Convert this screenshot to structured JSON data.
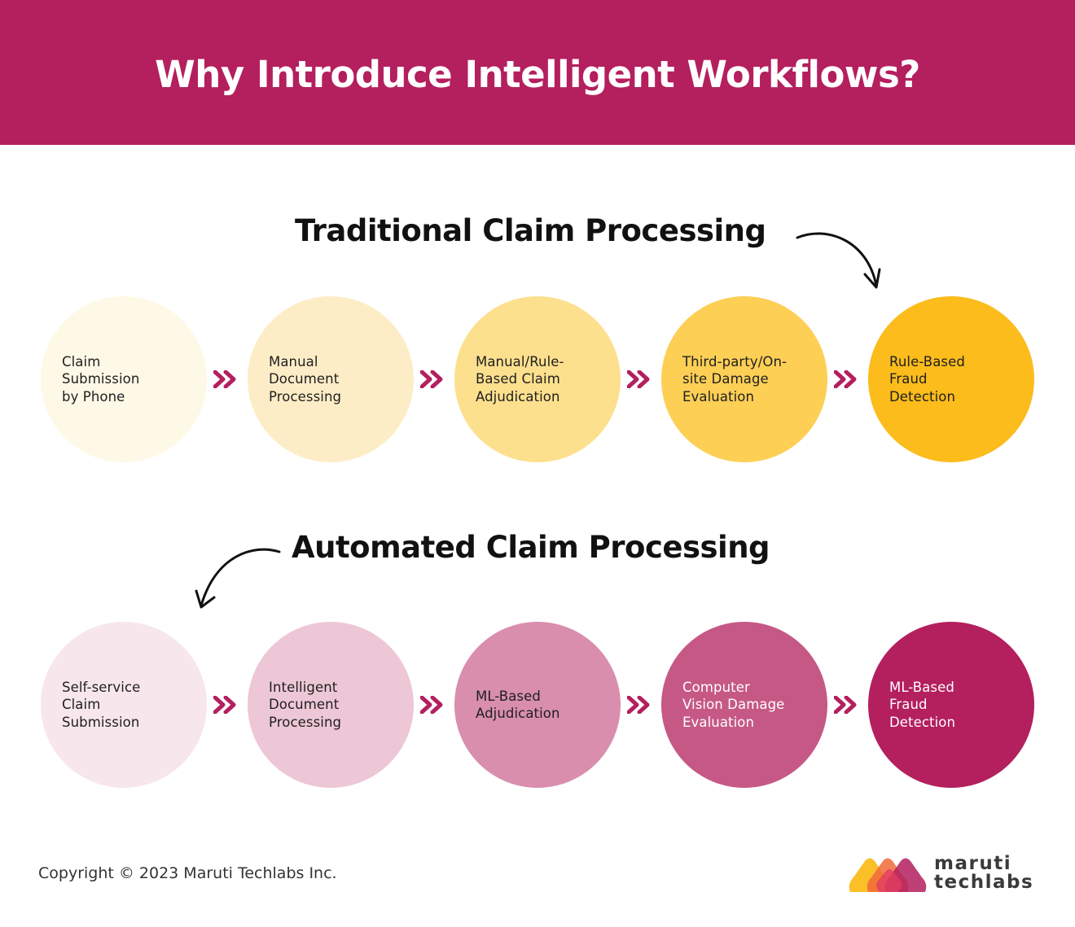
{
  "header": {
    "title": "Why Introduce Intelligent Workflows?",
    "background": "#b41f5e"
  },
  "traditional": {
    "title": "Traditional Claim Processing",
    "steps": [
      {
        "label": "Claim\nSubmission\nby Phone",
        "color": "#fef8e6"
      },
      {
        "label": "Manual\nDocument\nProcessing",
        "color": "#fdedc7"
      },
      {
        "label": "Manual/Rule-\nBased Claim\nAdjudication",
        "color": "#fde08e"
      },
      {
        "label": "Third-party/On-\nsite Damage\nEvaluation",
        "color": "#fdcf55"
      },
      {
        "label": "Rule-Based\nFraud\nDetection",
        "color": "#fbbc1c"
      }
    ]
  },
  "automated": {
    "title": "Automated Claim Processing",
    "steps": [
      {
        "label": "Self-service\nClaim\nSubmission",
        "color": "#f7e6ec"
      },
      {
        "label": "Intelligent\nDocument\nProcessing",
        "color": "#edc7d6"
      },
      {
        "label": "ML-Based\nAdjudication",
        "color": "#d98eae"
      },
      {
        "label": "Computer\nVision Damage\nEvaluation",
        "color": "#c65886"
      },
      {
        "label": "ML-Based\nFraud\nDetection",
        "color": "#b41f5e"
      }
    ]
  },
  "icons": {
    "step_connector": "double-chevron-right-icon",
    "section_arrow": "curved-arrow-icon"
  },
  "accent_color": "#b41f5e",
  "footer": {
    "copyright": "Copyright © 2023 Maruti Techlabs Inc.",
    "logo_line1": "maruti",
    "logo_line2": "techlabs"
  }
}
